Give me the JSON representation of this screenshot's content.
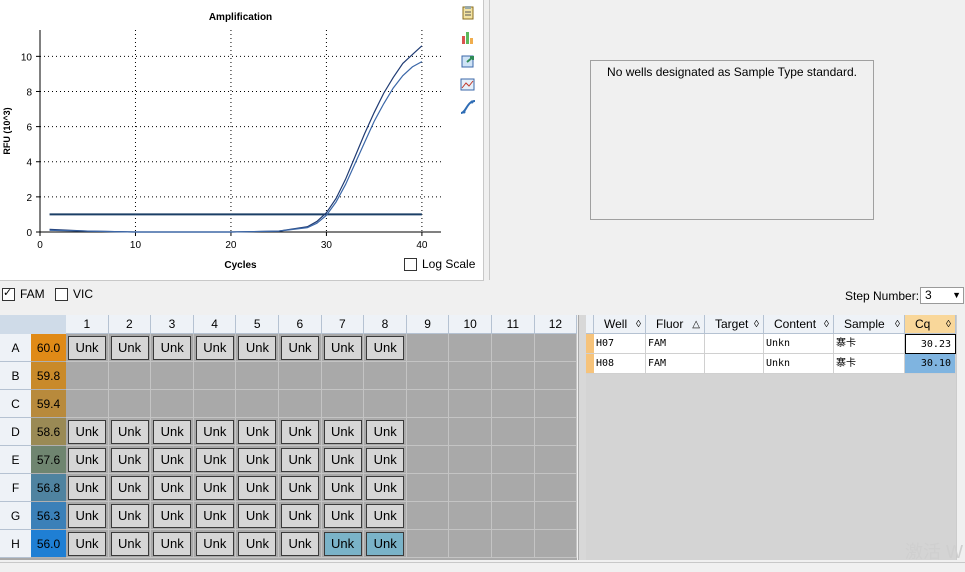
{
  "chart_data": {
    "type": "line",
    "title": "Amplification",
    "xlabel": "Cycles",
    "ylabel": "RFU (10^3)",
    "xlim": [
      0,
      42
    ],
    "ylim": [
      0,
      11.5
    ],
    "xticks": [
      0,
      10,
      20,
      30,
      40
    ],
    "yticks": [
      0,
      2,
      4,
      6,
      8,
      10
    ],
    "grid": true,
    "threshold": 1.0,
    "series": [
      {
        "x": [
          1,
          5,
          10,
          15,
          20,
          25,
          28,
          29,
          30,
          31,
          32,
          33,
          34,
          35,
          36,
          37,
          38,
          39,
          40
        ],
        "y": [
          0.15,
          0.05,
          0.0,
          0.0,
          0.0,
          0.05,
          0.3,
          0.6,
          1.1,
          1.9,
          3.0,
          4.3,
          5.6,
          6.8,
          7.9,
          8.8,
          9.6,
          10.1,
          10.6
        ],
        "color": "#1f3b73"
      },
      {
        "x": [
          1,
          5,
          10,
          15,
          20,
          25,
          28,
          29,
          30,
          31,
          32,
          33,
          34,
          35,
          36,
          37,
          38,
          39,
          40
        ],
        "y": [
          0.1,
          0.05,
          0.0,
          0.0,
          0.0,
          0.05,
          0.25,
          0.5,
          0.95,
          1.7,
          2.7,
          3.9,
          5.1,
          6.3,
          7.3,
          8.2,
          8.9,
          9.4,
          9.7
        ],
        "color": "#3b67a8"
      }
    ]
  },
  "chart_tools": [
    "copy-icon",
    "chart-type-icon",
    "export-icon",
    "zoom-icon",
    "curve-icon"
  ],
  "log_scale": {
    "label": "Log Scale",
    "checked": false
  },
  "standard_panel": {
    "message": "No wells designated as Sample Type standard."
  },
  "fluors": [
    {
      "label": "FAM",
      "checked": true
    },
    {
      "label": "VIC",
      "checked": false
    }
  ],
  "step": {
    "label": "Step Number:",
    "value": "3"
  },
  "plate": {
    "columns": [
      "1",
      "2",
      "3",
      "4",
      "5",
      "6",
      "7",
      "8",
      "9",
      "10",
      "11",
      "12"
    ],
    "rows": [
      {
        "label": "A",
        "temp": "60.0",
        "color": "#e08a17",
        "wells": [
          "Unk",
          "Unk",
          "Unk",
          "Unk",
          "Unk",
          "Unk",
          "Unk",
          "Unk",
          "",
          "",
          "",
          ""
        ]
      },
      {
        "label": "B",
        "temp": "59.8",
        "color": "#c98a2a",
        "wells": [
          "",
          "",
          "",
          "",
          "",
          "",
          "",
          "",
          "",
          "",
          "",
          ""
        ]
      },
      {
        "label": "C",
        "temp": "59.4",
        "color": "#b88a3c",
        "wells": [
          "",
          "",
          "",
          "",
          "",
          "",
          "",
          "",
          "",
          "",
          "",
          ""
        ]
      },
      {
        "label": "D",
        "temp": "58.6",
        "color": "#9a8a55",
        "wells": [
          "Unk",
          "Unk",
          "Unk",
          "Unk",
          "Unk",
          "Unk",
          "Unk",
          "Unk",
          "",
          "",
          "",
          ""
        ]
      },
      {
        "label": "E",
        "temp": "57.6",
        "color": "#6f8570",
        "wells": [
          "Unk",
          "Unk",
          "Unk",
          "Unk",
          "Unk",
          "Unk",
          "Unk",
          "Unk",
          "",
          "",
          "",
          ""
        ]
      },
      {
        "label": "F",
        "temp": "56.8",
        "color": "#4f83a0",
        "wells": [
          "Unk",
          "Unk",
          "Unk",
          "Unk",
          "Unk",
          "Unk",
          "Unk",
          "Unk",
          "",
          "",
          "",
          ""
        ]
      },
      {
        "label": "G",
        "temp": "56.3",
        "color": "#3b80b8",
        "wells": [
          "Unk",
          "Unk",
          "Unk",
          "Unk",
          "Unk",
          "Unk",
          "Unk",
          "Unk",
          "",
          "",
          "",
          ""
        ]
      },
      {
        "label": "H",
        "temp": "56.0",
        "color": "#1f7fd4",
        "wells": [
          "Unk",
          "Unk",
          "Unk",
          "Unk",
          "Unk",
          "Unk",
          "Unk",
          "Unk",
          "",
          "",
          "",
          ""
        ],
        "selected": [
          6,
          7
        ]
      }
    ]
  },
  "table": {
    "headers": [
      "Well",
      "Fluor",
      "Target",
      "Content",
      "Sample",
      "Cq"
    ],
    "rows": [
      {
        "well": "H07",
        "fluor": "FAM",
        "target": "",
        "content": "Unkn",
        "sample": "寨卡",
        "cq": "30.23"
      },
      {
        "well": "H08",
        "fluor": "FAM",
        "target": "",
        "content": "Unkn",
        "sample": "寨卡",
        "cq": "30.10"
      }
    ]
  },
  "watermark": "激活 W"
}
